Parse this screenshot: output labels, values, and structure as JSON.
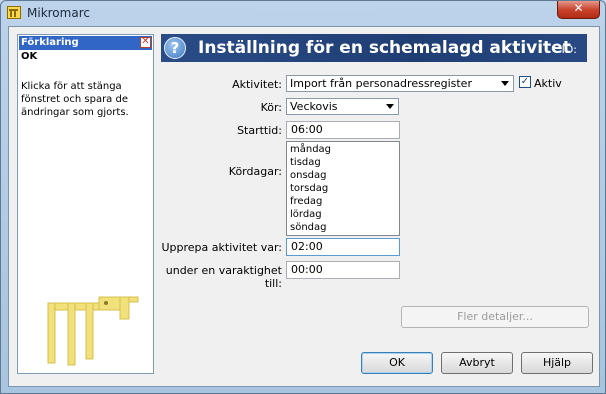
{
  "window": {
    "title": "Mikromarc",
    "close_symbol": "✕"
  },
  "help": {
    "header": "Förklaring",
    "close_symbol": "✕",
    "title": "OK",
    "text": "Klicka för att stänga fönstret och spara de ändringar som gjorts."
  },
  "banner": {
    "title": "Inställning för en schemalagd aktivitet",
    "id_label": "ID:"
  },
  "form": {
    "activity": {
      "label": "Aktivitet:",
      "value": "Import från personadressregister"
    },
    "active": {
      "label": "Aktiv",
      "checked": true,
      "check_symbol": "✓"
    },
    "run": {
      "label": "Kör:",
      "value": "Veckovis"
    },
    "start_time": {
      "label": "Starttid:",
      "value": "06:00"
    },
    "run_days": {
      "label": "Kördagar:",
      "days": [
        "måndag",
        "tisdag",
        "onsdag",
        "torsdag",
        "fredag",
        "lördag",
        "söndag"
      ]
    },
    "repeat": {
      "label": "Upprepa aktivitet var:",
      "value": "02:00"
    },
    "duration": {
      "label": "under en varaktighet till:",
      "value": "00:00"
    }
  },
  "buttons": {
    "more_details": "Fler detaljer...",
    "ok": "OK",
    "cancel": "Avbryt",
    "help": "Hjälp"
  },
  "colors": {
    "banner": "#1f3e74",
    "help_header": "#3166c6",
    "logo": "#f2e07a"
  }
}
